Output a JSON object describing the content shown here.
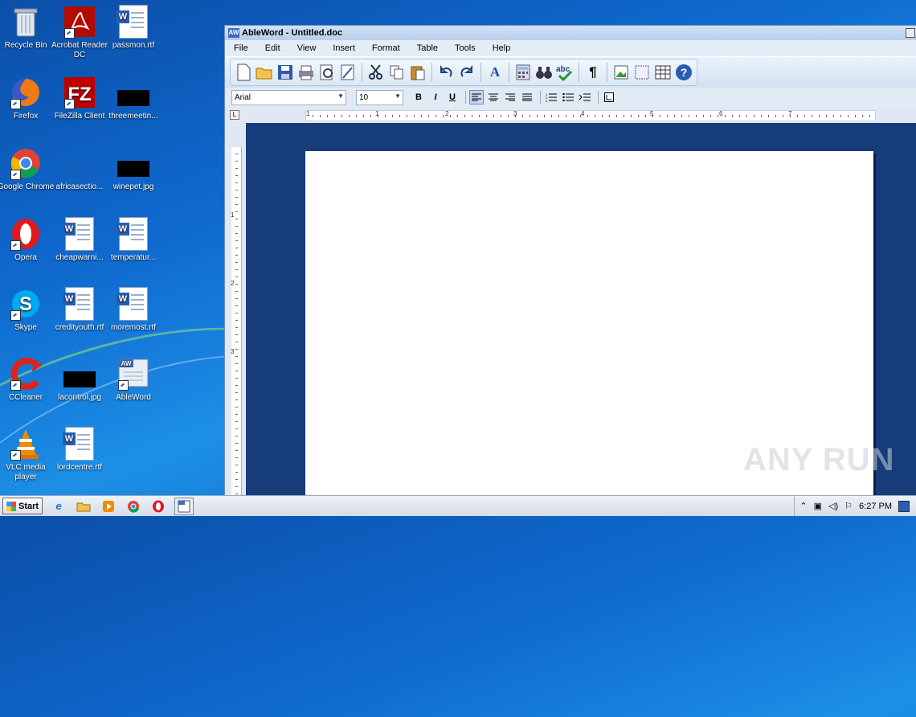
{
  "desktop": {
    "icons": [
      {
        "label": "Recycle Bin",
        "icon": "recycle-bin-icon"
      },
      {
        "label": "Acrobat Reader DC",
        "icon": "acrobat-icon"
      },
      {
        "label": "passmon.rtf",
        "icon": "word-doc-icon"
      },
      {
        "label": "Firefox",
        "icon": "firefox-icon"
      },
      {
        "label": "FileZilla Client",
        "icon": "filezilla-icon"
      },
      {
        "label": "threemeetin...",
        "icon": "black-thumbnail-icon"
      },
      {
        "label": "Google Chrome",
        "icon": "chrome-icon"
      },
      {
        "label": "africasectio...",
        "icon": "blue-thumbnail-icon"
      },
      {
        "label": "winepet.jpg",
        "icon": "black-thumbnail-icon"
      },
      {
        "label": "Opera",
        "icon": "opera-icon"
      },
      {
        "label": "cheapwarni...",
        "icon": "word-doc-icon"
      },
      {
        "label": "temperatur...",
        "icon": "word-doc-icon"
      },
      {
        "label": "Skype",
        "icon": "skype-icon"
      },
      {
        "label": "credityouth.rtf",
        "icon": "word-doc-icon"
      },
      {
        "label": "moremost.rtf",
        "icon": "word-doc-icon"
      },
      {
        "label": "CCleaner",
        "icon": "ccleaner-icon"
      },
      {
        "label": "lacontrol.jpg",
        "icon": "black-thumbnail-icon"
      },
      {
        "label": "AbleWord",
        "icon": "ableword-icon"
      },
      {
        "label": "VLC media player",
        "icon": "vlc-icon"
      },
      {
        "label": "lordcentre.rtf",
        "icon": "word-doc-icon"
      }
    ]
  },
  "window": {
    "app_badge": "AW",
    "title": "AbleWord - Untitled.doc",
    "menu": [
      "File",
      "Edit",
      "View",
      "Insert",
      "Format",
      "Table",
      "Tools",
      "Help"
    ],
    "font_name": "Arial",
    "font_size": "10",
    "bold": "B",
    "italic": "I",
    "underline": "U",
    "ruler_numbers": [
      "1",
      "1",
      "2",
      "3",
      "4",
      "5",
      "6",
      "7"
    ],
    "vruler_numbers": [
      "1",
      "2",
      "3"
    ]
  },
  "taskbar": {
    "start_label": "Start",
    "clock": "6:27 PM"
  },
  "watermark": "ANY RUN"
}
